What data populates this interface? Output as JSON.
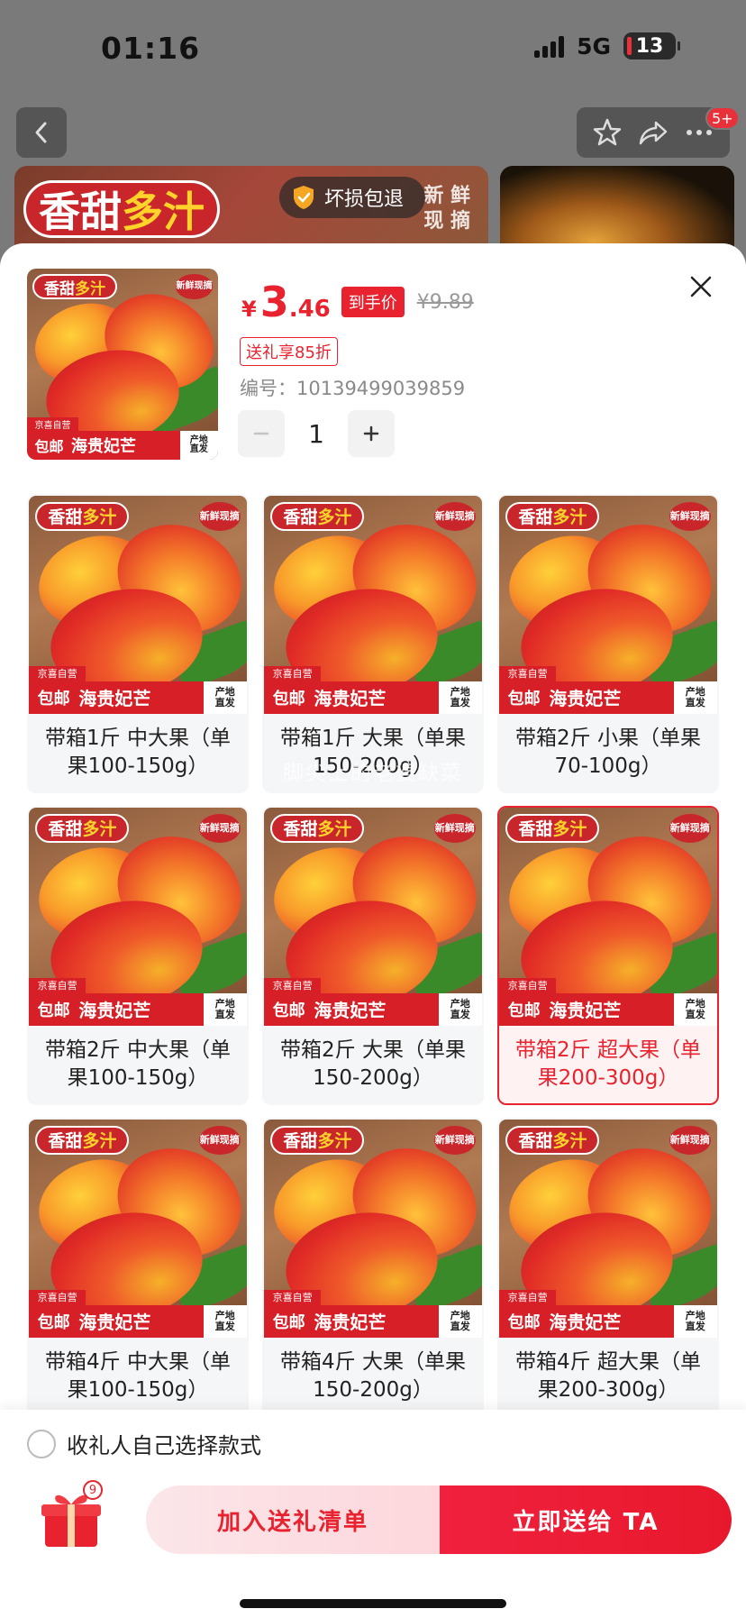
{
  "status_bar": {
    "time": "01:16",
    "network": "5G",
    "battery": "13"
  },
  "nav": {
    "badge": "5+",
    "icons": [
      "back-arrow-icon",
      "star-icon",
      "share-icon",
      "more-icon"
    ]
  },
  "backdrop": {
    "banner_tag_a": "香甜",
    "banner_tag_b": "多汁",
    "banner_fresh_1": "新 鲜",
    "banner_fresh_2": "现 摘",
    "refund_text": "坏损包退"
  },
  "product_image": {
    "top_a": "香甜",
    "top_b": "多汁",
    "new_1": "新鲜",
    "new_2": "现摘",
    "jd": "京喜自营",
    "post": "包邮",
    "name": "海贵妃芒",
    "origin_1": "产地",
    "origin_2": "直发"
  },
  "summary": {
    "price_symbol": "¥",
    "price_int": "3",
    "price_dec": ".46",
    "price_tag": "到手价",
    "price_old": "¥9.89",
    "gift_discount": "送礼享85折",
    "sku_code": "编号：10139499039859",
    "quantity": "1"
  },
  "watermark": "脚尖上的老婆缺菜",
  "options": [
    {
      "label": "带箱1斤 中大果（单果100-150g）",
      "selected": false
    },
    {
      "label": "带箱1斤 大果（单果150-200g）",
      "selected": false
    },
    {
      "label": "带箱2斤 小果（单果70-100g）",
      "selected": false
    },
    {
      "label": "带箱2斤 中大果（单果100-150g）",
      "selected": false
    },
    {
      "label": "带箱2斤 大果（单果150-200g）",
      "selected": false
    },
    {
      "label": "带箱2斤 超大果（单果200-300g）",
      "selected": true
    },
    {
      "label": "带箱4斤 中大果（单果100-150g）",
      "selected": false
    },
    {
      "label": "带箱4斤 大果（单果150-200g）",
      "selected": false
    },
    {
      "label": "带箱4斤 超大果（单果200-300g）",
      "selected": false
    }
  ],
  "bottom": {
    "self_choose": "收礼人自己选择款式",
    "gift_count": "9",
    "add_label": "加入送礼清单",
    "send_label": "立即送给 TA"
  },
  "colors": {
    "accent": "#e8232f",
    "selected_bg": "#fff2f2",
    "card_bg": "#f5f6f8"
  }
}
